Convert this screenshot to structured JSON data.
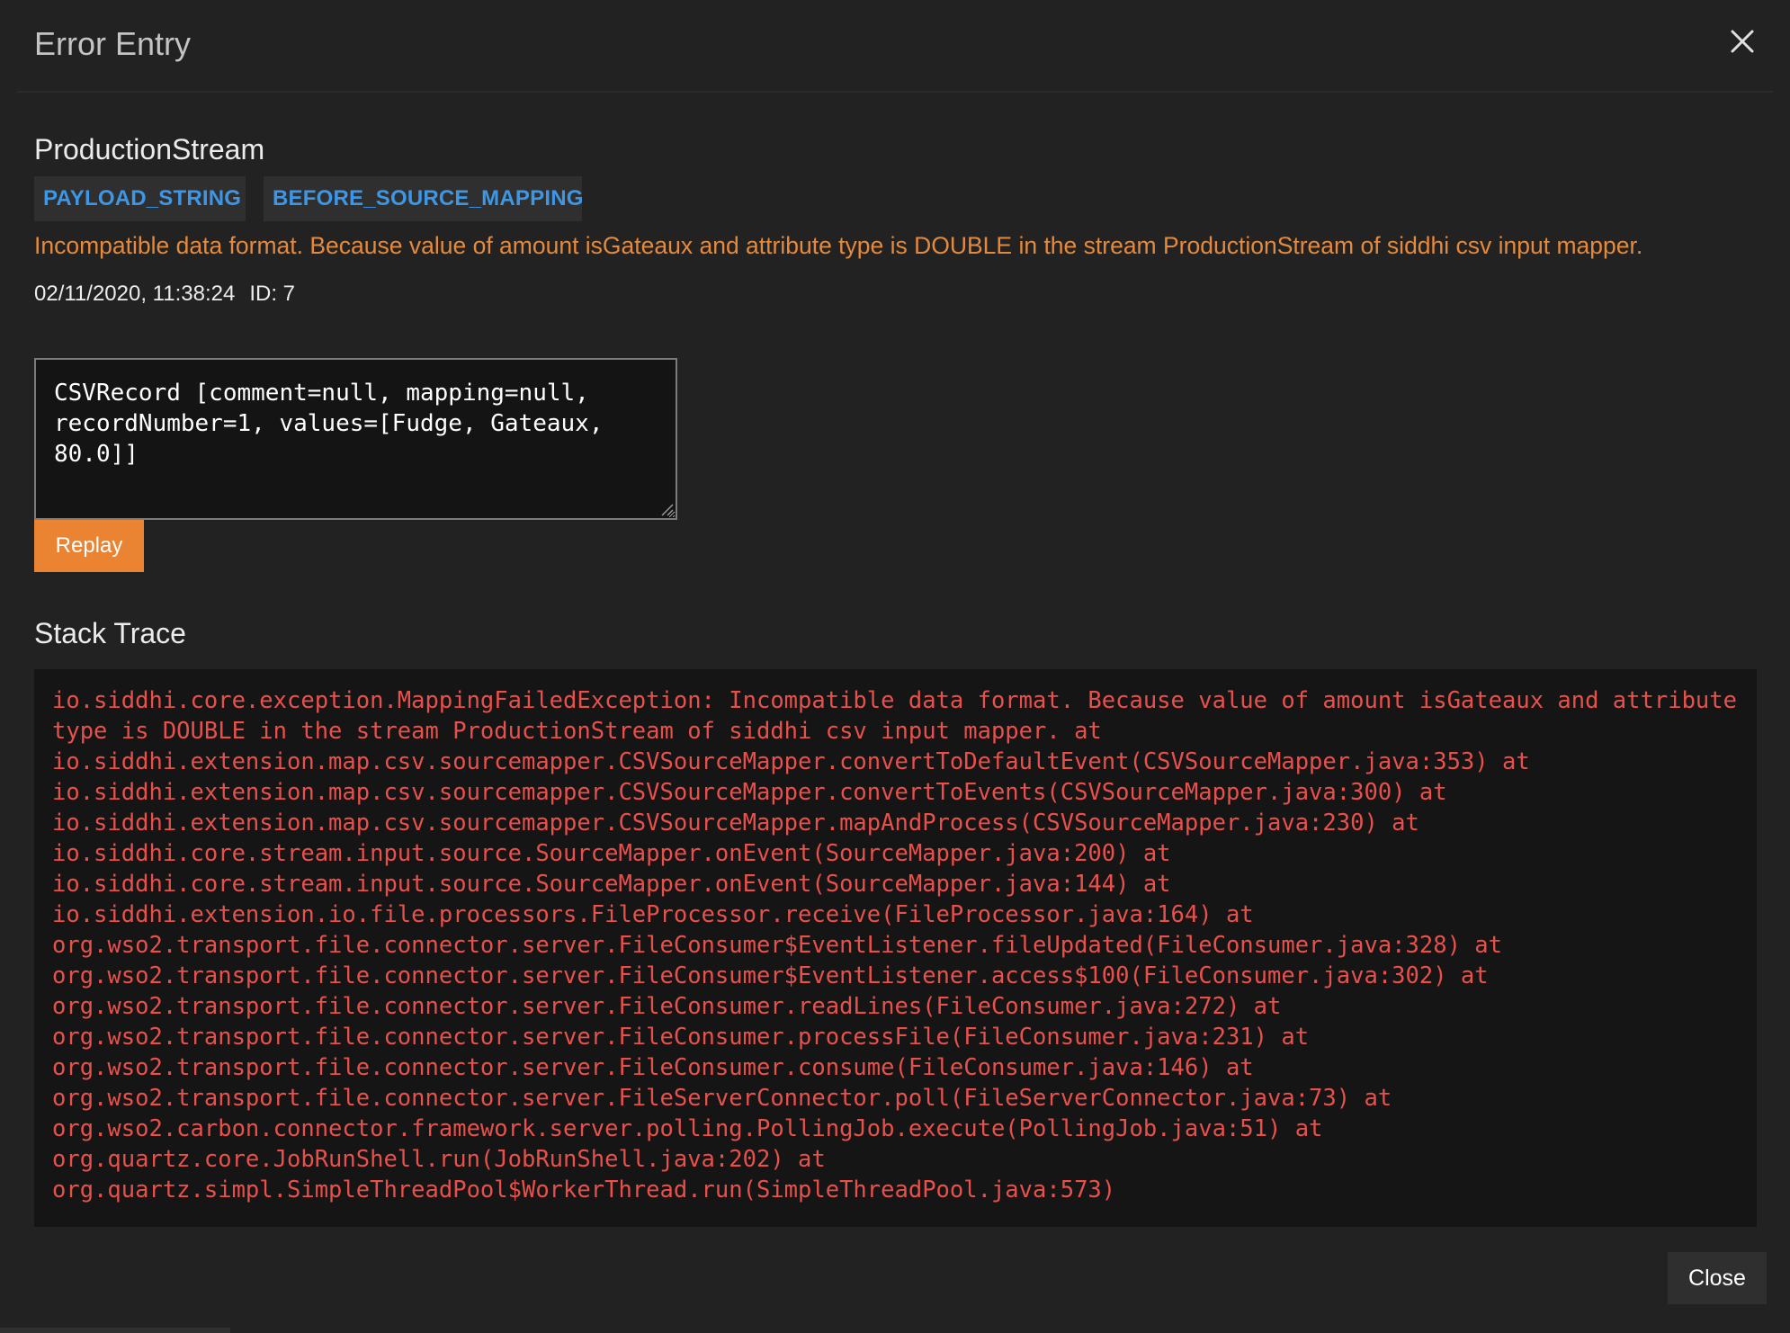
{
  "dialog": {
    "title": "Error Entry",
    "close_icon": "close-icon"
  },
  "entry": {
    "stream_name": "ProductionStream",
    "tags": [
      "PAYLOAD_STRING",
      "BEFORE_SOURCE_MAPPING"
    ],
    "error_message": "Incompatible data format. Because value of amount isGateaux and attribute type is DOUBLE in the stream ProductionStream of siddhi csv input mapper.",
    "timestamp": "02/11/2020, 11:38:24",
    "id_label": "ID: 7",
    "payload": "CSVRecord [comment=null, mapping=null, recordNumber=1, values=[Fudge, Gateaux, 80.0]]",
    "replay_label": "Replay"
  },
  "stack_trace": {
    "heading": "Stack Trace",
    "lines": [
      "io.siddhi.core.exception.MappingFailedException: Incompatible data format. Because value of amount isGateaux and attribute",
      "type is DOUBLE in the stream ProductionStream of siddhi csv input mapper. at",
      "io.siddhi.extension.map.csv.sourcemapper.CSVSourceMapper.convertToDefaultEvent(CSVSourceMapper.java:353) at",
      "io.siddhi.extension.map.csv.sourcemapper.CSVSourceMapper.convertToEvents(CSVSourceMapper.java:300) at",
      "io.siddhi.extension.map.csv.sourcemapper.CSVSourceMapper.mapAndProcess(CSVSourceMapper.java:230) at",
      "io.siddhi.core.stream.input.source.SourceMapper.onEvent(SourceMapper.java:200) at",
      "io.siddhi.core.stream.input.source.SourceMapper.onEvent(SourceMapper.java:144) at",
      "io.siddhi.extension.io.file.processors.FileProcessor.receive(FileProcessor.java:164) at",
      "org.wso2.transport.file.connector.server.FileConsumer$EventListener.fileUpdated(FileConsumer.java:328) at",
      "org.wso2.transport.file.connector.server.FileConsumer$EventListener.access$100(FileConsumer.java:302) at",
      "org.wso2.transport.file.connector.server.FileConsumer.readLines(FileConsumer.java:272) at",
      "org.wso2.transport.file.connector.server.FileConsumer.processFile(FileConsumer.java:231) at",
      "org.wso2.transport.file.connector.server.FileConsumer.consume(FileConsumer.java:146) at",
      "org.wso2.transport.file.connector.server.FileServerConnector.poll(FileServerConnector.java:73) at",
      "org.wso2.carbon.connector.framework.server.polling.PollingJob.execute(PollingJob.java:51) at",
      "org.quartz.core.JobRunShell.run(JobRunShell.java:202) at",
      "org.quartz.simpl.SimpleThreadPool$WorkerThread.run(SimpleThreadPool.java:573)"
    ]
  },
  "footer": {
    "close_label": "Close"
  },
  "colors": {
    "background": "#222222",
    "accent_orange": "#ea8433",
    "error_text": "#e58a3c",
    "tag_text": "#3d97e6",
    "stack_text": "#e8504c"
  }
}
